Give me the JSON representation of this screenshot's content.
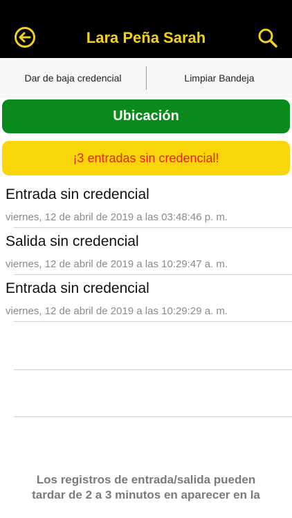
{
  "header": {
    "title": "Lara Peña Sarah",
    "back_icon": "arrow-left-circle-icon",
    "search_icon": "search-icon",
    "accent_color": "#f2d21b"
  },
  "actions": {
    "left_label": "Dar de baja credencial",
    "right_label": "Limpiar Bandeja"
  },
  "location_button": {
    "label": "Ubicación",
    "color": "#0a8a1c"
  },
  "alert": {
    "text": "¡3 entradas sin credencial!",
    "bg_color": "#f8d60a",
    "text_color": "#e0231c"
  },
  "records": [
    {
      "type": "Entrada sin credencial",
      "date": "viernes, 12 de abril de 2019  a las 03:48:46 p. m."
    },
    {
      "type": "Salida sin credencial",
      "date": "viernes, 12 de abril de 2019  a las 10:29:47 a. m."
    },
    {
      "type": "Entrada sin credencial",
      "date": "viernes, 12 de abril de 2019  a las 10:29:29 a. m."
    }
  ],
  "footer": {
    "line1": "Los registros de entrada/salida pueden",
    "line2": "tardar de 2 a 3 minutos en aparecer en la"
  }
}
